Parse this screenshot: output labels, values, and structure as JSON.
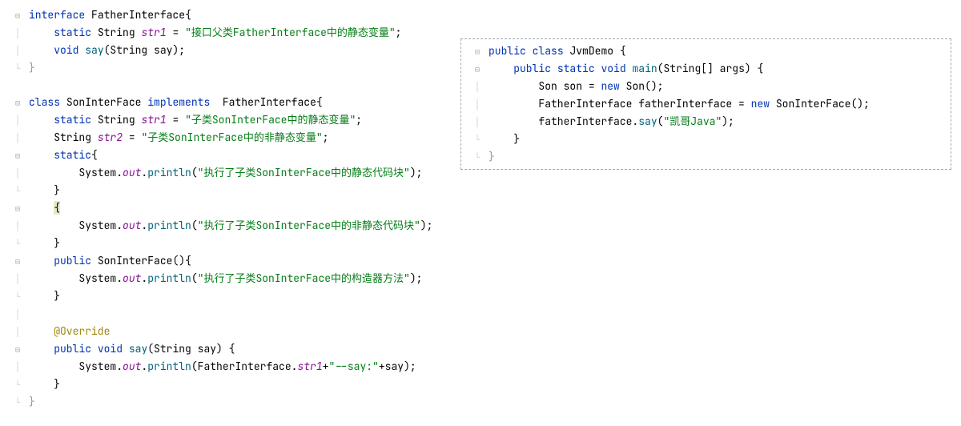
{
  "left": {
    "l1": {
      "kw1": "interface",
      "name": "FatherInterface",
      "brace": "{"
    },
    "l2": {
      "kw1": "static",
      "type": "String",
      "field": "str1",
      "eq": " = ",
      "str": "\"接口父类FatherInterface中的静态变量\"",
      "semi": ";"
    },
    "l3": {
      "kw1": "void",
      "method": "say",
      "paren": "(String say);"
    },
    "l4": {
      "brace": "}"
    },
    "l5": {
      "blank": ""
    },
    "l6": {
      "kw1": "class",
      "name": "SonInterFace",
      "kw2": "implements",
      "name2": "FatherInterface",
      "brace": "{"
    },
    "l7": {
      "kw1": "static",
      "type": "String",
      "field": "str1",
      "eq": " = ",
      "str": "\"子类SonInterFace中的静态变量\"",
      "semi": ";"
    },
    "l8": {
      "type": "String",
      "field": "str2",
      "eq": " = ",
      "str": "\"子类SonInterFace中的非静态变量\"",
      "semi": ";"
    },
    "l9": {
      "kw1": "static",
      "brace": "{"
    },
    "l10": {
      "obj": "System.",
      "out": "out",
      "dot": ".",
      "method": "println",
      "paren": "(",
      "str": "\"执行了子类SonInterFace中的静态代码块\"",
      "close": ");"
    },
    "l11": {
      "brace": "}"
    },
    "l12": {
      "brace": "{"
    },
    "l13": {
      "obj": "System.",
      "out": "out",
      "dot": ".",
      "method": "println",
      "paren": "(",
      "str": "\"执行了子类SonInterFace中的非静态代码块\"",
      "close": ");"
    },
    "l14": {
      "brace": "}"
    },
    "l15": {
      "kw1": "public",
      "name": "SonInterFace",
      "paren": "(){"
    },
    "l16": {
      "obj": "System.",
      "out": "out",
      "dot": ".",
      "method": "println",
      "paren": "(",
      "str": "\"执行了子类SonInterFace中的构造器方法\"",
      "close": ");"
    },
    "l17": {
      "brace": "}"
    },
    "l18": {
      "blank": ""
    },
    "l19": {
      "anno": "@Override"
    },
    "l20": {
      "kw1": "public",
      "kw2": "void",
      "method": "say",
      "paren": "(String say) {"
    },
    "l21": {
      "obj": "System.",
      "out": "out",
      "dot": ".",
      "method": "println",
      "paren": "(FatherInterface.",
      "field": "str1",
      "plus": "+",
      "str": "\"--say:\"",
      "plus2": "+say);"
    },
    "l22": {
      "brace": "}"
    },
    "l23": {
      "brace": "}"
    }
  },
  "right": {
    "r1": {
      "kw1": "public",
      "kw2": "class",
      "name": "JvmDemo",
      "brace": " {"
    },
    "r2": {
      "kw1": "public",
      "kw2": "static",
      "kw3": "void",
      "method": "main",
      "paren": "(String[] args) {"
    },
    "r3": {
      "type": "Son",
      "var": "son",
      "eq": " = ",
      "kw": "new",
      "ctor": "Son",
      "paren": "();"
    },
    "r4": {
      "type": "FatherInterface",
      "var": "fatherInterface",
      "eq": " = ",
      "kw": "new",
      "ctor": "SonInterFace",
      "paren": "();"
    },
    "r5": {
      "obj": "fatherInterface.",
      "method": "say",
      "paren": "(",
      "str": "\"凯哥Java\"",
      "close": ");"
    },
    "r6": {
      "brace": "}"
    },
    "r7": {
      "brace": "}"
    }
  },
  "fold_icons": {
    "collapse": "⊟",
    "expand": "⊞",
    "line": "│",
    "corner": "└"
  }
}
